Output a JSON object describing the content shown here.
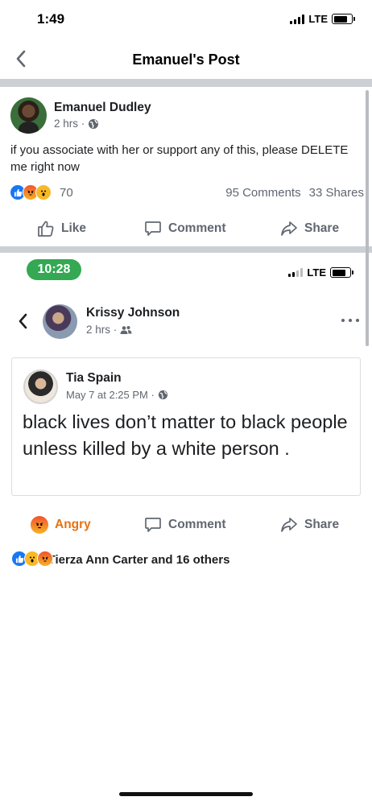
{
  "status_bar": {
    "time": "1:49",
    "network": "LTE"
  },
  "nav": {
    "title": "Emanuel's Post"
  },
  "post": {
    "author": "Emanuel Dudley",
    "meta": "2 hrs ·",
    "text": "if you associate with her or support any of this, please DELETE me right now",
    "reactions": {
      "count": "70",
      "comments": "95 Comments",
      "shares": "33 Shares"
    },
    "actions": {
      "like": "Like",
      "comment": "Comment",
      "share": "Share"
    }
  },
  "embedded_screenshot": {
    "time": "10:28",
    "network": "LTE",
    "author": "Krissy Johnson",
    "meta": "2 hrs ·",
    "shared_post": {
      "author": "Tia Spain",
      "meta": "May 7 at 2:25 PM ·",
      "text": "black lives don’t matter to black people unless killed by a white person ."
    },
    "actions": {
      "angry": "Angry",
      "comment": "Comment",
      "share": "Share"
    },
    "reactions_text": "You, Tierza Ann Carter and 16 others"
  },
  "colors": {
    "facebook_blue": "#1877f2",
    "angry_orange": "#e9710f",
    "time_pill_green": "#34a853",
    "secondary_text": "#606770",
    "divider": "#ccd0d5"
  }
}
